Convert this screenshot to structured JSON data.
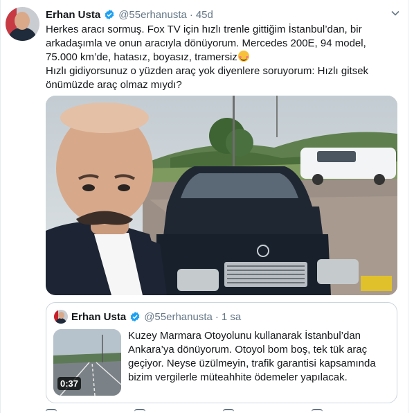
{
  "tweet": {
    "author_name": "Erhan Usta",
    "handle": "@55erhanusta",
    "separator": "·",
    "time": "45d",
    "text_p1": "Herkes aracı sormuş. Fox TV için hızlı trenle gittiğim İstanbul’dan, bir arkadaşımla ve onun aracıyla dönüyorum. Mercedes 200E, 94 model, 75.000 km’de, hatasız, boyasız, tramersiz",
    "text_p2": "Hızlı gidiyorsunuz o yüzden araç yok diyenlere soruyorum: Hızlı gitsek önümüzde araç olmaz mıydı?"
  },
  "quoted_tweet": {
    "author_name": "Erhan Usta",
    "handle": "@55erhanusta",
    "separator": "·",
    "time": "1 sa",
    "text": "Kuzey Marmara Otoyolunu kullanarak İstanbul’dan Ankara’ya dönüyorum. Otoyol bom boş, tek tük araç geçiyor. Neyse üzülmeyin, trafik garantisi kapsamında bizim vergilerle müteahhite ödemeler yapılacak.",
    "video_duration": "0:37"
  },
  "icons": {
    "verified": "verified-badge-icon",
    "caret": "chevron-down-icon",
    "emoji": "smiling-face-with-blush-emoji"
  },
  "colors": {
    "verified_blue": "#1da1f2",
    "secondary_text": "#657786",
    "border": "#ccd6dd",
    "text": "#14171a"
  }
}
